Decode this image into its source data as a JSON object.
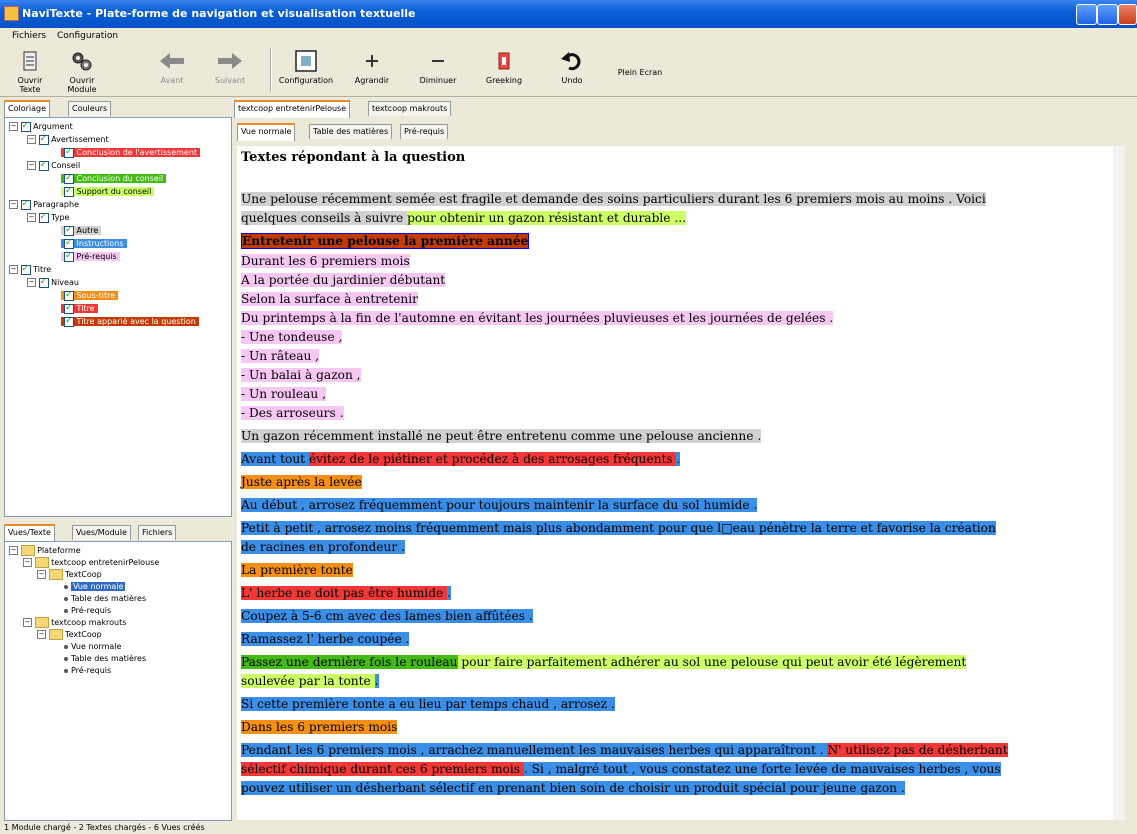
{
  "window": {
    "title": "NaviTexte - Plate-forme de navigation et visualisation textuelle"
  },
  "menu": [
    "Fichiers",
    "Configuration"
  ],
  "toolbar": {
    "ouvrir_texte": "Ouvrir Texte",
    "ouvrir_module": "Ouvrir Module",
    "avant": "Avant",
    "suivant": "Suivant",
    "configuration": "Configuration",
    "agrandir": "Agrandir",
    "diminuer": "Diminuer",
    "greeking": "Greeking",
    "undo": "Undo",
    "plein_ecran": "Plein Ecran"
  },
  "left_top_tabs": [
    "Coloriage",
    "Couleurs"
  ],
  "coloriage": {
    "argument": "Argument",
    "avertissement": "Avertissement",
    "conclusion_avert": "Conclusion de l'avertissement",
    "conseil": "Conseil",
    "conclusion_conseil": "Conclusion du conseil",
    "support_conseil": "Support du conseil",
    "paragraphe": "Paragraphe",
    "type": "Type",
    "autre": "Autre",
    "instructions": "Instructions",
    "prerequis": "Pré-requis",
    "titre": "Titre",
    "niveau": "Niveau",
    "sous_titre": "Sous-titre",
    "titre2": "Titre",
    "titre_apparie": "Titre apparié avec la question"
  },
  "left_bottom_tabs": [
    "Vues/Texte",
    "Vues/Module",
    "Fichiers"
  ],
  "vues": {
    "plateforme": "Plateforme",
    "t1": "textcoop entretenirPelouse",
    "tc1": "TextCoop",
    "vue_normale": "Vue normale",
    "tdm": "Table des matières",
    "prereq": "Pré-requis",
    "t2": "textcoop makrouts",
    "tc2": "TextCoop"
  },
  "doc_tabs": [
    "textcoop entretenirPelouse",
    "textcoop makrouts"
  ],
  "view_tabs": [
    "Vue normale",
    "Table des matières",
    "Pré-requis"
  ],
  "doc": {
    "heading": "Textes répondant à la question",
    "l1a": "   Une pelouse récemment semée est fragile et demande des soins particuliers durant les 6 premiers mois au moins . Voici",
    "l2a": "quelques conseils à suivre ",
    "l2b": "pour obtenir un gazon résistant et durable ...",
    "l2c": " ",
    "l3a": "   ",
    "l3b": "Entretenir une pelouse la première année",
    "l4": "   Durant les 6 premiers mois",
    "l5": "A la portée du jardinier débutant",
    "l6": "Selon la surface à entretenir",
    "l7": "Du printemps à la fin de l'automne en évitant les journées pluvieuses et les journées de gelées .",
    "l8": "- Une tondeuse ,",
    "l9": "- Un râteau ,",
    "l10": "- Un balai à gazon ,",
    "l11": "- Un rouleau ,",
    "l12": "- Des arroseurs .",
    "l13": "   Un gazon récemment installé ne peut être entretenu comme une pelouse ancienne .",
    "l14a": "   Avant tout ",
    "l14b": "évitez de le piétiner et procédez à des arrosages fréquents ",
    "l14c": ".",
    "l15a": "   ",
    "l15b": "Juste après la levée",
    "l16": "   Au début , arrosez fréquemment pour toujours maintenir la surface du sol humide .",
    "l17": "   Petit à petit , arrosez moins fréquemment mais plus abondamment pour que l□eau pénètre la terre et  favorise la création",
    "l18": "de racines en profondeur .",
    "l19a": "   ",
    "l19b": "La première tonte",
    "l20a": "   ",
    "l20b": "L' herbe ne  doit pas être  humide ",
    "l20c": ".",
    "l21": "   Coupez à 5-6 cm avec des lames bien affûtées .",
    "l22": "   Ramassez l' herbe coupée .",
    "l23a": "   ",
    "l23b": "Passez une dernière fois le rouleau",
    "l23c": " pour faire parfaitement adhérer au sol une pelouse qui peut avoir été légèrement",
    "l24a": "soulevée par la tonte ",
    "l24b": ".",
    "l25": "   Si cette première tonte a eu lieu par temps chaud , arrosez .",
    "l26a": "   ",
    "l26b": "Dans les 6 premiers mois",
    "l27a": "   Pendant les 6 premiers mois , arrachez manuellement les mauvaises herbes qui apparaîtront . ",
    "l27b": "N' utilisez pas de désherbant",
    "l28a": "sélectif chimique durant ces 6 premiers mois ",
    "l28b": ". Si , malgré tout , vous constatez une forte levée de mauvaises herbes , vous",
    "l29": "pouvez utiliser un désherbant sélectif en prenant bien soin de choisir un produit spécial pour jeune gazon ."
  },
  "status": "1 Module chargé   -   2 Textes chargés   -   6 Vues créés",
  "colors": {
    "gray": "#d1d1d1",
    "lime": "#ccff66",
    "pink": "#f5c7f2",
    "blue": "#3b8ee6",
    "red": "#f03838",
    "orange": "#f58f14",
    "green": "#44bb14",
    "darkred": "#c33b05"
  }
}
